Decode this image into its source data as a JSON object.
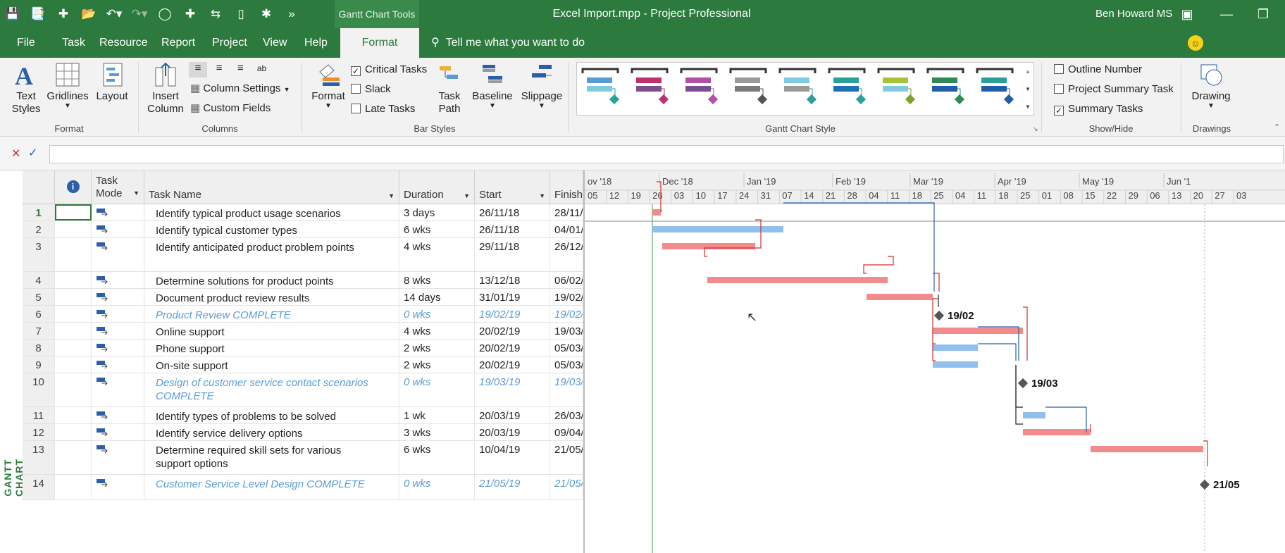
{
  "titlebar": {
    "context_tab": "Gantt Chart Tools",
    "window_title": "Excel Import.mpp  -  Project Professional",
    "user": "Ben Howard MS"
  },
  "menu": {
    "tabs": [
      "File",
      "Task",
      "Resource",
      "Report",
      "Project",
      "View",
      "Help",
      "Format"
    ],
    "tell_me": "Tell me what you want to do"
  },
  "ribbon": {
    "format_group": {
      "label": "Format",
      "text_styles": "Text Styles",
      "gridlines": "Gridlines",
      "layout": "Layout"
    },
    "columns_group": {
      "label": "Columns",
      "insert_column": "Insert Column",
      "column_settings": "Column Settings",
      "custom_fields": "Custom Fields"
    },
    "bar_styles_group": {
      "label": "Bar Styles",
      "format": "Format",
      "critical_tasks": "Critical Tasks",
      "slack": "Slack",
      "late_tasks": "Late Tasks",
      "task_path": "Task Path",
      "baseline": "Baseline",
      "slippage": "Slippage"
    },
    "gantt_style_group": {
      "label": "Gantt Chart Style"
    },
    "show_hide_group": {
      "label": "Show/Hide",
      "outline_number": "Outline Number",
      "project_summary_task": "Project Summary Task",
      "summary_tasks": "Summary Tasks"
    },
    "drawings_group": {
      "label": "Drawings",
      "drawing": "Drawing"
    }
  },
  "style_swatch_colors": [
    [
      "#5b9bd5",
      "#7fcbe0",
      "#2aa198"
    ],
    [
      "#c0306f",
      "#7a4f8f",
      "#c0306f"
    ],
    [
      "#b24fa8",
      "#7a4f8f",
      "#b24fa8"
    ],
    [
      "#9a9a9a",
      "#7a7a7a",
      "#555555"
    ],
    [
      "#7fcbe0",
      "#9a9a9a",
      "#2aa198"
    ],
    [
      "#2aa198",
      "#1f6fb4",
      "#2aa198"
    ],
    [
      "#a5c33b",
      "#7fcbe0",
      "#7aa12a"
    ],
    [
      "#2e8b57",
      "#1f5fa8",
      "#2e8b57"
    ],
    [
      "#2aa198",
      "#1f5fa8",
      "#1f5fa8"
    ]
  ],
  "table": {
    "headers": {
      "mode": "Task Mode",
      "name": "Task Name",
      "duration": "Duration",
      "start": "Start",
      "finish": "Finish"
    },
    "rows": [
      {
        "id": "1",
        "name": "Identify typical product usage scenarios",
        "name2": "",
        "duration": "3 days",
        "start": "26/11/18",
        "finish": "28/11/"
      },
      {
        "id": "2",
        "name": "Identify typical customer types",
        "name2": "",
        "duration": "6 wks",
        "start": "26/11/18",
        "finish": "04/01/"
      },
      {
        "id": "3",
        "name": "Identify anticipated product problem points",
        "name2": "",
        "duration": "4 wks",
        "start": "29/11/18",
        "finish": "26/12/"
      },
      {
        "id": "4",
        "name": "Determine solutions for product points",
        "name2": "",
        "duration": "8 wks",
        "start": "13/12/18",
        "finish": "06/02/"
      },
      {
        "id": "5",
        "name": "Document product review results",
        "name2": "",
        "duration": "14 days",
        "start": "31/01/19",
        "finish": "19/02/"
      },
      {
        "id": "6",
        "name": "Product Review COMPLETE",
        "name2": "",
        "duration": "0 wks",
        "start": "19/02/19",
        "finish": "19/02/"
      },
      {
        "id": "7",
        "name": "Online support",
        "name2": "",
        "duration": "4 wks",
        "start": "20/02/19",
        "finish": "19/03/"
      },
      {
        "id": "8",
        "name": "Phone support",
        "name2": "",
        "duration": "2 wks",
        "start": "20/02/19",
        "finish": "05/03/"
      },
      {
        "id": "9",
        "name": "On-site support",
        "name2": "",
        "duration": "2 wks",
        "start": "20/02/19",
        "finish": "05/03/"
      },
      {
        "id": "10",
        "name": "Design of customer service contact scenarios",
        "name2": "COMPLETE",
        "duration": "0 wks",
        "start": "19/03/19",
        "finish": "19/03/"
      },
      {
        "id": "11",
        "name": "Identify types of problems to be solved",
        "name2": "",
        "duration": "1 wk",
        "start": "20/03/19",
        "finish": "26/03/"
      },
      {
        "id": "12",
        "name": "Identify service delivery options",
        "name2": "",
        "duration": "3 wks",
        "start": "20/03/19",
        "finish": "09/04/"
      },
      {
        "id": "13",
        "name": "Determine required skill sets for various",
        "name2": "support options",
        "duration": "6 wks",
        "start": "10/04/19",
        "finish": "21/05/"
      },
      {
        "id": "14",
        "name": "Customer Service Level Design COMPLETE",
        "name2": "",
        "duration": "0 wks",
        "start": "21/05/19",
        "finish": "21/05/"
      }
    ]
  },
  "gantt": {
    "vertical_label": "GANTT CHART",
    "months": [
      "ov '18",
      "Dec '18",
      "Jan '19",
      "Feb '19",
      "Mar '19",
      "Apr '19",
      "May '19",
      "Jun '1"
    ],
    "days": [
      "05",
      "12",
      "19",
      "26",
      "03",
      "10",
      "17",
      "24",
      "31",
      "07",
      "14",
      "21",
      "28",
      "04",
      "11",
      "18",
      "25",
      "04",
      "11",
      "18",
      "25",
      "01",
      "08",
      "15",
      "22",
      "29",
      "06",
      "13",
      "20",
      "27",
      "03"
    ],
    "milestone_labels": [
      "19/02",
      "19/03",
      "21/05"
    ]
  }
}
